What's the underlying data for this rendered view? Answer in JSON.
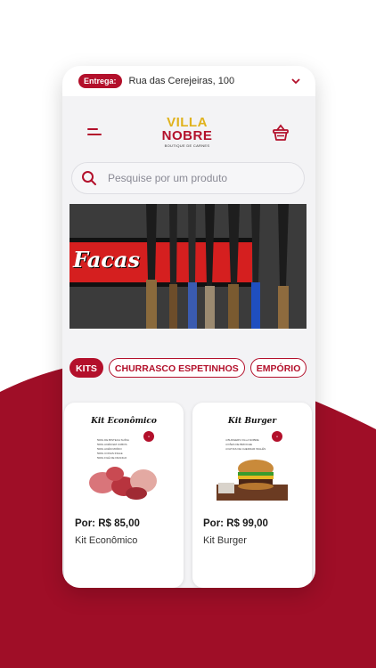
{
  "colors": {
    "brand_red": "#b3102b",
    "logo_gold": "#e0b21c",
    "screen_bg": "#f3f3f5"
  },
  "delivery": {
    "label": "Entrega:",
    "address": "Rua das Cerejeiras, 100",
    "chevron_icon": "chevron-down-icon"
  },
  "header": {
    "menu_icon": "hamburger-menu-icon",
    "logo": {
      "line1": "VILLA",
      "line2": "NOBRE",
      "subtitle": "BOUTIQUE DE CARNES"
    },
    "cart_icon": "basket-icon"
  },
  "search": {
    "placeholder": "Pesquise por um produto",
    "value": ""
  },
  "banner": {
    "text": "Facas"
  },
  "categories": [
    {
      "label": "KITS",
      "active": true
    },
    {
      "label": "CHURRASCO ESPETINHOS",
      "active": false
    },
    {
      "label": "EMPÓRIO",
      "active": false
    }
  ],
  "products": [
    {
      "thumb_title": "Kit Econômico",
      "thumb_lines": [
        "500G DE BISTECA SUÍNA",
        "500G ACÉM EM CUBOS",
        "500G ACÉM MOÍDO",
        "500G CONAS INGLE",
        "500G FILÉ DE FRANGO"
      ],
      "price": "Por: R$ 85,00",
      "name": "Kit Econômico"
    },
    {
      "thumb_title": "Kit Burger",
      "thumb_lines": [
        "4 BURGERS VILLA NOBRE",
        "4 PÃES DE BRIOCHE",
        "4 FATIAS DE CHEDDAR INGLÊS"
      ],
      "price": "Por: R$ 99,00",
      "name": "Kit Burger"
    }
  ]
}
